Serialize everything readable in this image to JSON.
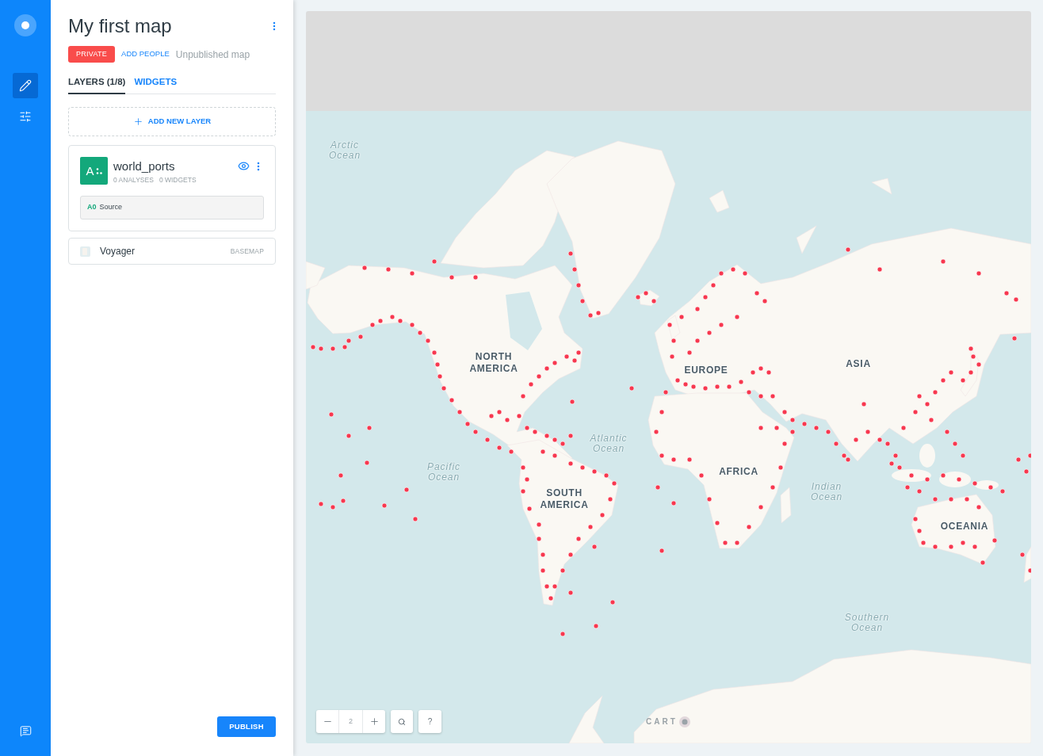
{
  "sidebar": {
    "items": [
      {
        "kind": "edit",
        "selected": true
      },
      {
        "kind": "settings",
        "selected": false
      }
    ]
  },
  "map_title": "My first map",
  "status_row": {
    "privacy": "PRIVATE",
    "add_people": "ADD PEOPLE",
    "state": "Unpublished map"
  },
  "tabs": [
    {
      "label": "LAYERS (1/8)",
      "selected": true
    },
    {
      "label": "WIDGETS",
      "selected": false
    }
  ],
  "add_layer": "ADD NEW LAYER",
  "layers": [
    {
      "letter": "A",
      "name": "world_ports",
      "analyses": "0 ANALYSES",
      "widgets": "0 WIDGETS",
      "visible": true,
      "source": {
        "id": "A0",
        "label": "Source"
      }
    }
  ],
  "basemap": {
    "name": "Voyager",
    "tag": "BASEMAP"
  },
  "publish": "PUBLISH",
  "map": {
    "labels": [
      {
        "text": "Arctic Ocean",
        "kind": "ocean"
      },
      {
        "text": "NORTH AMERICA",
        "kind": "continent"
      },
      {
        "text": "Atlantic Ocean",
        "kind": "ocean"
      },
      {
        "text": "Pacific Ocean",
        "kind": "ocean"
      },
      {
        "text": "EUROPE",
        "kind": "continent"
      },
      {
        "text": "ASIA",
        "kind": "continent"
      },
      {
        "text": "AFRICA",
        "kind": "continent"
      },
      {
        "text": "SOUTH AMERICA",
        "kind": "continent"
      },
      {
        "text": "Indian Ocean",
        "kind": "ocean"
      },
      {
        "text": "OCEANIA",
        "kind": "continent"
      },
      {
        "text": "Southern Ocean",
        "kind": "ocean"
      }
    ],
    "zoom_level": "2",
    "help": "?",
    "logo_text": "CART"
  }
}
